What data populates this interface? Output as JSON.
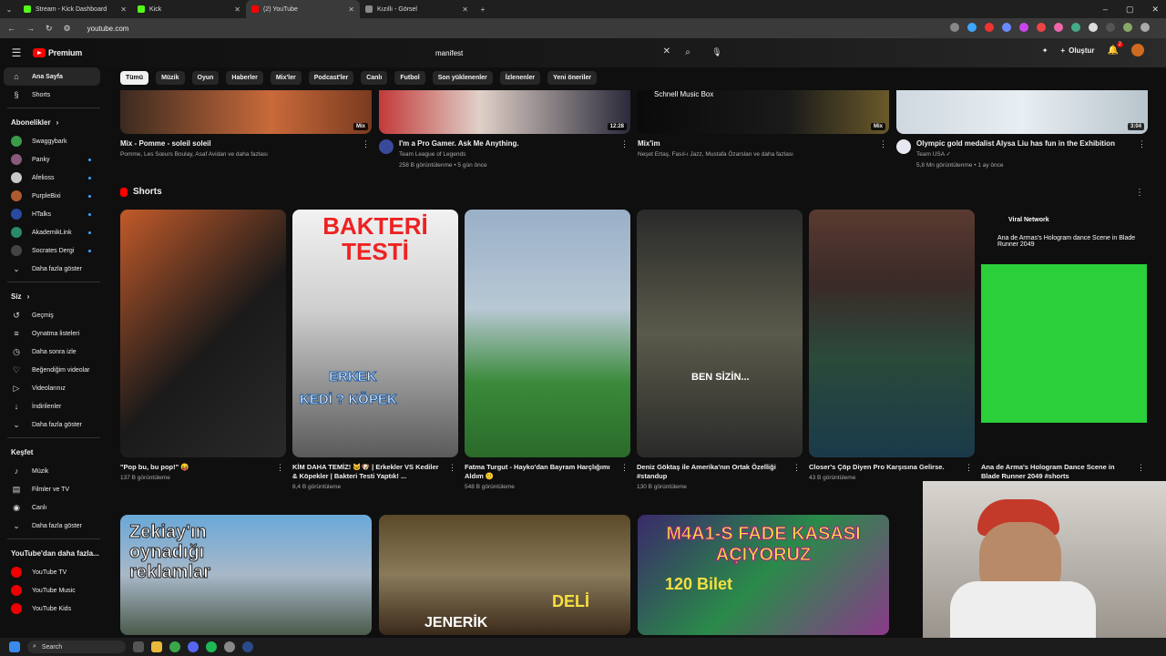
{
  "browser": {
    "tabs": [
      {
        "title": "Stream - Kick Dashboard",
        "color": "#53fc18",
        "active": false
      },
      {
        "title": "Kick",
        "color": "#53fc18",
        "active": false
      },
      {
        "title": "(2) YouTube",
        "color": "#ff0000",
        "active": true
      },
      {
        "title": "Kızıllı - Görsel",
        "color": "#888888",
        "active": false
      }
    ],
    "new_tab": "+",
    "url": "youtube.com"
  },
  "header": {
    "logo_text": "Premium",
    "search_value": "manifest",
    "create_label": "Oluştur",
    "notif_count": "2"
  },
  "sidebar": {
    "main": [
      {
        "label": "Ana Sayfa",
        "icon": "⌂",
        "active": true
      },
      {
        "label": "Shorts",
        "icon": "§",
        "active": false
      }
    ],
    "subs_title": "Abonelikler",
    "subs": [
      {
        "label": "Swaggybark",
        "color": "#3a9a4a",
        "dot": false
      },
      {
        "label": "Panky",
        "color": "#8a5a7a",
        "dot": true
      },
      {
        "label": "Afelioss",
        "color": "#c9c9c9",
        "dot": true
      },
      {
        "label": "PurpleBixi",
        "color": "#b05a30",
        "dot": true
      },
      {
        "label": "HTalks",
        "color": "#2a4aa0",
        "dot": true
      },
      {
        "label": "AkademikLink",
        "color": "#2a8a6a",
        "dot": true
      },
      {
        "label": "Socrates Dergi",
        "color": "#444444",
        "dot": true
      }
    ],
    "more1": "Daha fazla göster",
    "you_title": "Siz",
    "you": [
      {
        "label": "Geçmiş",
        "icon": "↺"
      },
      {
        "label": "Oynatma listeleri",
        "icon": "≡"
      },
      {
        "label": "Daha sonra izle",
        "icon": "◷"
      },
      {
        "label": "Beğendiğim videolar",
        "icon": "♡"
      },
      {
        "label": "Videolarınız",
        "icon": "▷"
      },
      {
        "label": "İndirilenler",
        "icon": "↓"
      }
    ],
    "more2": "Daha fazla göster",
    "explore_title": "Keşfet",
    "explore": [
      {
        "label": "Müzik",
        "icon": "♪"
      },
      {
        "label": "Filmler ve TV",
        "icon": "▤"
      },
      {
        "label": "Canlı",
        "icon": "◉"
      }
    ],
    "more3": "Daha fazla göster",
    "yt_more_title": "YouTube'dan daha fazla...",
    "yt_more": [
      {
        "label": "YouTube TV"
      },
      {
        "label": "YouTube Music"
      },
      {
        "label": "YouTube Kids"
      }
    ]
  },
  "chips": [
    "Tümü",
    "Müzik",
    "Oyun",
    "Haberler",
    "Mix'ler",
    "Podcast'ler",
    "Canlı",
    "Futbol",
    "Son yüklenenler",
    "İzlenenler",
    "Yeni öneriler"
  ],
  "videos": [
    {
      "title": "Mix - Pomme - soleil soleil",
      "meta1": "Pomme, Les Sœurs Boulay, Asaf Avidan ve daha fazlası",
      "meta2": "",
      "badge": "Mix",
      "avatar": false,
      "bg": "linear-gradient(90deg,#3a2a20,#c96a3a 60%,#7a3a20)"
    },
    {
      "title": "I'm a Pro Gamer. Ask Me Anything.",
      "meta1": "Team League of Legends",
      "meta2": "258 B görüntülenme • 5 gün önce",
      "badge": "12:28",
      "avatar": true,
      "avcolor": "#3a4a9a",
      "bg": "linear-gradient(90deg,#c23a3a,#e0d0c8 40%,#2a2a3a)"
    },
    {
      "title": "Mix'im",
      "meta1": "Neşet Ertaş, Fasıl-ı Jazz, Mustafa Özarslan ve daha fazlası",
      "meta2": "",
      "badge": "Mix",
      "avatar": false,
      "overlay": "Schnell Music Box",
      "bg": "linear-gradient(90deg,#0a0a0a,#1a1a1a 60%,#6a5a2a)"
    },
    {
      "title": "Olympic gold medalist Alysa Liu has fun in the Exhibition",
      "meta1": "Team USA ✓",
      "meta2": "5,8 Mn görüntülenme • 1 ay önce",
      "badge": "3:04",
      "avatar": true,
      "avcolor": "#e8e8f0",
      "bg": "linear-gradient(90deg,#cfd8e0,#e8eef2 50%,#b8c4cc)"
    }
  ],
  "shorts": {
    "title": "Shorts",
    "items": [
      {
        "title": "\"Pop bu, bu pop!\" 😝",
        "meta": "137 B görüntüleme",
        "overlay": "",
        "bg": "linear-gradient(135deg,#c25a2a,#1a1a1a 55%,#2a2a2a)"
      },
      {
        "title": "KİM DAHA TEMİZ! 🐱🐶 | Erkekler VS Kediler & Köpekler | Bakteri Testi Yaptık! ...",
        "meta": "8,4 B görüntüleme",
        "overlay": "BAKTERİ TESTİ",
        "overlay2": "ERKEK",
        "overlay3": "KEDİ ? KÖPEK",
        "bg": "linear-gradient(180deg,#f2f2f2,#cfcfcf 40%,#5a5a5a)"
      },
      {
        "title": "Fatma Turgut - Hayko'dan Bayram Harçlığımı Aldım 🙂",
        "meta": "548 B görüntüleme",
        "overlay": "",
        "bg": "linear-gradient(180deg,#9ab0c8,#b8c8d4 40%,#3a8a3a 70%,#2a6a2a)"
      },
      {
        "title": "Deniz Göktaş ile Amerika'nın Ortak Özelliği #standup",
        "meta": "130 B görüntüleme",
        "overlay": "BEN SİZİN...",
        "bg": "linear-gradient(180deg,#2a2a2a,#5a5a4a 50%,#2a2a2a)"
      },
      {
        "title": "Closer's Çöp Diyen Pro Karşısına Gelirse.",
        "meta": "43 B görüntüleme",
        "overlay": "",
        "bg": "linear-gradient(180deg,#5a3a30,#3a2a28 30%,#2a4a3a 60%,#1a3a4a)"
      },
      {
        "title": "Ana de Arma's Hologram Dance Scene in Blade Runner 2049 #shorts",
        "meta": "",
        "overlay": "Viral Network",
        "overlay2": "Ana de Armas's Hologram dance Scene in Blade Runner 2049",
        "bg": "linear-gradient(180deg,#0f0f0f 0%,#0f0f0f 22%,#2acf3a 22%,#2acf3a 86%,#0f0f0f 86%)"
      }
    ]
  },
  "bottom": [
    {
      "overlay": "Zekiay'ın oynadığı reklamlar",
      "bg": "linear-gradient(180deg,#6aa8d8,#a8b8c8 50%,#4a5a4a)"
    },
    {
      "overlay": "JENERİK",
      "overlay2": "DELİ",
      "bg": "linear-gradient(180deg,#5a4a2a,#8a7a5a 50%,#3a2a1a)"
    },
    {
      "overlay": "M4A1-S FADE KASASI AÇIYORUZ",
      "overlay2": "120 Bilet",
      "bg": "linear-gradient(135deg,#3a2a6a,#2a8a4a 50%,#8a3a8a)"
    }
  ],
  "taskbar": {
    "search": "Search"
  }
}
